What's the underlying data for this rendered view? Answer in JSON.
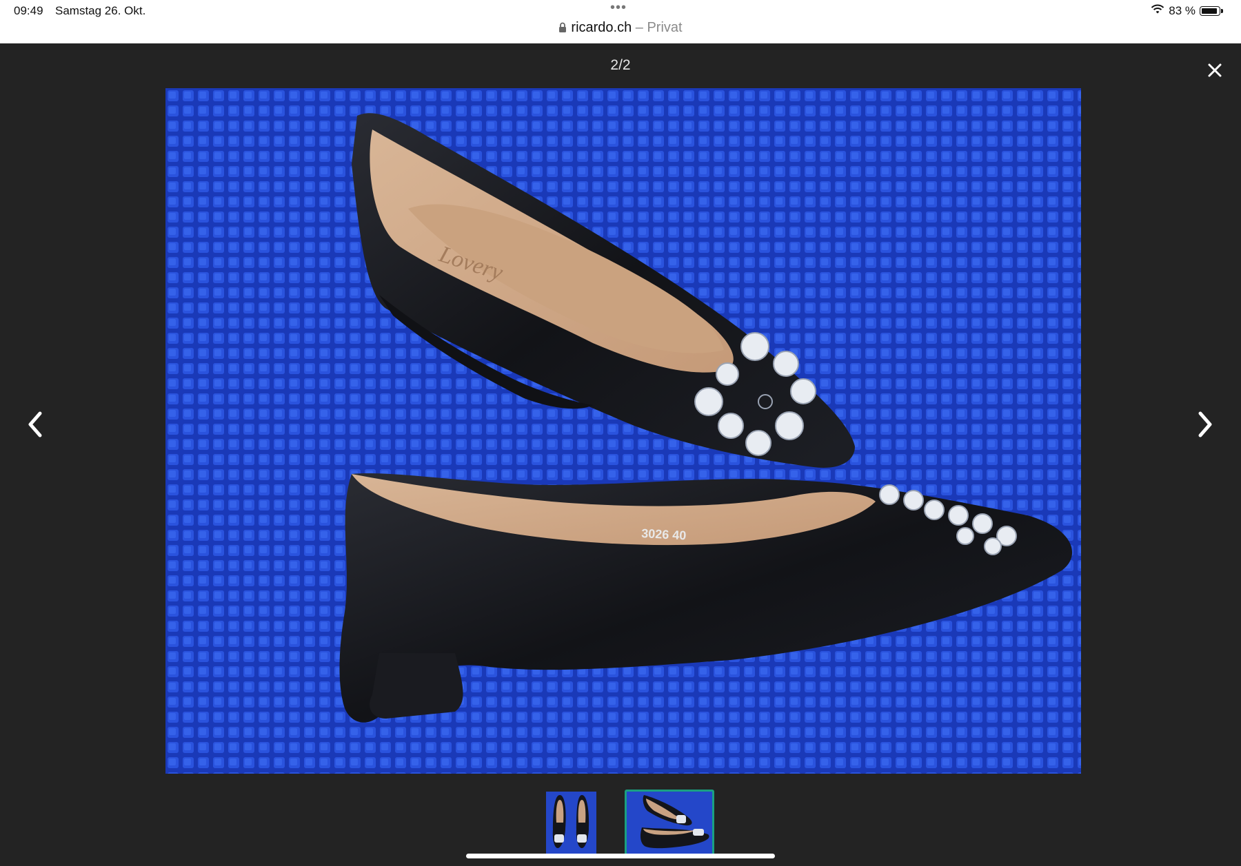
{
  "status_bar": {
    "time": "09:49",
    "date": "Samstag 26. Okt.",
    "dots": "•••",
    "url": "ricardo.ch",
    "separator": " – ",
    "privacy": "Privat",
    "battery": "83 %"
  },
  "viewer": {
    "counter": "2/2",
    "current_index": 2,
    "total": 2,
    "photo_label": "3026 40",
    "photo_brand": "Lovery"
  },
  "thumbnails": [
    {
      "selected": false
    },
    {
      "selected": true
    }
  ],
  "colors": {
    "background": "#232323",
    "selected_thumb_border": "#1aa082",
    "status_bar": "#ffffff"
  }
}
